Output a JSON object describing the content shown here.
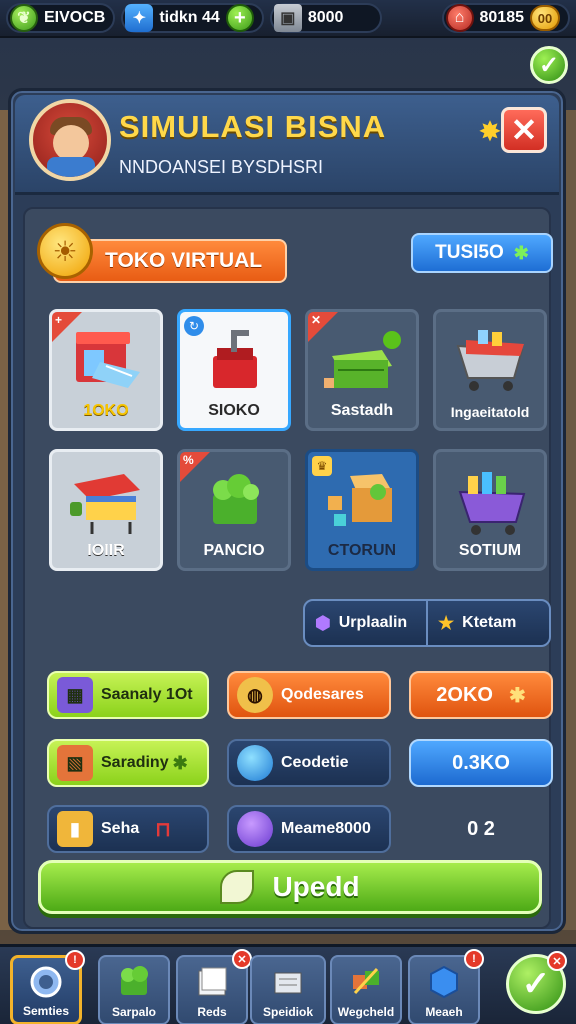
{
  "topbar": {
    "res1_value": "EIVOCB",
    "res2_value": "tidkn 44",
    "res3_value": "8000",
    "res4_value": "80185",
    "res4_badge": "00"
  },
  "panel": {
    "title": "SIMULASI BISNA",
    "subtitle": "NNDOANSEI BYSDHSRI"
  },
  "tabs": {
    "primary_label": "TOKO VIRTUAL",
    "secondary_label": "TUSI5O"
  },
  "items": [
    {
      "label": "1OKO",
      "label_color": "#f6c400"
    },
    {
      "label": "SIOKO",
      "label_color": "#2a2a2a"
    },
    {
      "label": "Sastadh",
      "label_color": "#ffffff"
    },
    {
      "label": "Ingaeitatold",
      "label_color": "#ffffff"
    },
    {
      "label": "IOIIR",
      "label_color": "#ffffff"
    },
    {
      "label": "PANCIO",
      "label_color": "#ffffff"
    },
    {
      "label": "CTORUN",
      "label_color": "#1c2a44"
    },
    {
      "label": "SOTIUM",
      "label_color": "#ffffff"
    }
  ],
  "split": {
    "left_label": "Urplaalin",
    "right_label": "Ktetam"
  },
  "controls": {
    "lime1_label": "Saanaly 1Ot",
    "orange1_label": "Qodesares",
    "orange2_value": "2OKO",
    "lime2_label": "Saradiny",
    "navy1_label": "Ceodetie",
    "blue1_value": "0.3KO",
    "navy2_label": "Seha",
    "navy3_label": "Meame8000",
    "ghost_value": "0 2"
  },
  "update_button": {
    "label": "Upedd"
  },
  "nav": [
    {
      "label": "Semties"
    },
    {
      "label": "Sarpalo"
    },
    {
      "label": "Reds"
    },
    {
      "label": "Speidiok"
    },
    {
      "label": "Wegcheld"
    },
    {
      "label": "Meaeh"
    }
  ]
}
